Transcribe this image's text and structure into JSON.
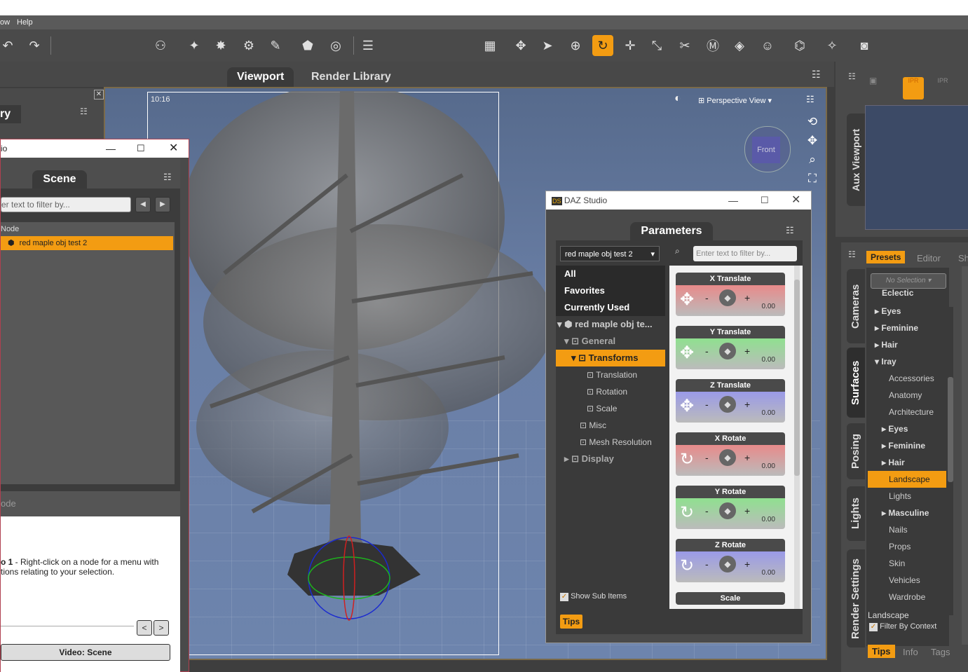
{
  "menubar": {
    "items": [
      "ow",
      "Help"
    ]
  },
  "tabs": {
    "viewport": "Viewport",
    "render_library": "Render Library"
  },
  "viewport": {
    "frame_label": "10:16",
    "perspective": "Perspective View",
    "cube_label": "Front"
  },
  "library_fragment": {
    "title": "ry"
  },
  "scene_window": {
    "title": "io",
    "tab": "Scene",
    "filter_placeholder": "er text to filter by...",
    "column_header": "Node",
    "selected_node": "red maple obj test 2",
    "lower_header": "ode",
    "tip_bold": "o 1",
    "tip_text": " - Right-click on a node for a menu with",
    "tip_text2": "tions relating to your selection.",
    "video_button": "Video: Scene"
  },
  "params_window": {
    "title": "DAZ Studio",
    "tab": "Parameters",
    "node_select": "red maple obj test 2",
    "filter_placeholder": "Enter text to filter by...",
    "tree": {
      "all": "All",
      "favorites": "Favorites",
      "currently_used": "Currently Used",
      "node": "red maple obj te...",
      "general": "General",
      "transforms": "Transforms",
      "translation": "Translation",
      "rotation": "Rotation",
      "scale": "Scale",
      "misc": "Misc",
      "mesh_resolution": "Mesh Resolution",
      "display": "Display"
    },
    "show_sub_items": "Show Sub Items",
    "tips_button": "Tips",
    "params": [
      {
        "label": "X Translate",
        "value": "0.00",
        "color": "#e88a8a"
      },
      {
        "label": "Y Translate",
        "value": "0.00",
        "color": "#8fe08f"
      },
      {
        "label": "Z Translate",
        "value": "0.00",
        "color": "#9a9ae8"
      },
      {
        "label": "X Rotate",
        "value": "0.00",
        "color": "#e88a8a"
      },
      {
        "label": "Y Rotate",
        "value": "0.00",
        "color": "#8fe08f"
      },
      {
        "label": "Z Rotate",
        "value": "0.00",
        "color": "#9a9ae8"
      },
      {
        "label": "Scale",
        "value": "",
        "color": "#cccccc"
      }
    ]
  },
  "aux": {
    "label": "Aux Viewport"
  },
  "right_tabs": [
    "Cameras",
    "Surfaces",
    "Posing",
    "Lights",
    "Render Settings"
  ],
  "surfaces_panel": {
    "tabs": {
      "presets": "Presets",
      "editor": "Editor",
      "shader": "Sh"
    },
    "selection": "No Selection",
    "items": [
      "Eclectic",
      "Eyes",
      "Feminine",
      "Hair",
      "Iray",
      "Accessories",
      "Anatomy",
      "Architecture",
      "Eyes",
      "Feminine",
      "Hair",
      "Landscape",
      "Lights",
      "Masculine",
      "Nails",
      "Props",
      "Skin",
      "Vehicles",
      "Wardrobe"
    ],
    "footer": "Landscape",
    "filter_by_context": "Filter By Context",
    "bottom_tabs": {
      "tips": "Tips",
      "info": "Info",
      "tags": "Tags"
    }
  },
  "colors": {
    "accent": "#f39c12",
    "bg_dark": "#3e3e3e"
  }
}
